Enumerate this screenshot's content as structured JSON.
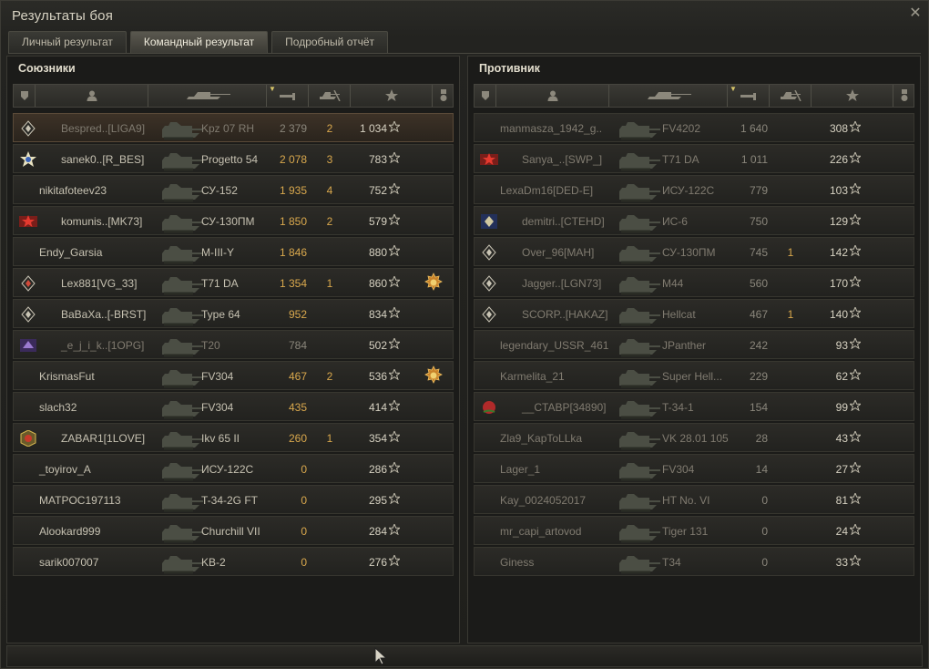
{
  "window": {
    "title": "Результаты боя",
    "close_icon": "close-icon"
  },
  "tabs": [
    {
      "label": "Личный результат",
      "active": false
    },
    {
      "label": "Командный результат",
      "active": true
    },
    {
      "label": "Подробный отчёт",
      "active": false
    }
  ],
  "allies": {
    "title": "Союзники",
    "rows": [
      {
        "badge": "clan-diamond",
        "player": "Bespred..[LIGA9]",
        "vehicle": "Kpz 07 RH",
        "damage": "2 379",
        "kills": "2",
        "xp": "1 034",
        "self": true,
        "dead": true,
        "medal": ""
      },
      {
        "badge": "clan-star",
        "player": "sanek0..[R_BES]",
        "vehicle": "Progetto 54",
        "damage": "2 078",
        "kills": "3",
        "xp": "783",
        "medal": ""
      },
      {
        "badge": "",
        "player": "nikitafoteev23",
        "vehicle": "СУ-152",
        "damage": "1 935",
        "kills": "4",
        "xp": "752",
        "medal": ""
      },
      {
        "badge": "clan-red-star",
        "player": "komunis..[MK73]",
        "vehicle": "СУ-130ПМ",
        "damage": "1 850",
        "kills": "2",
        "xp": "579",
        "medal": ""
      },
      {
        "badge": "",
        "player": "Endy_Garsia",
        "vehicle": "M-III-Y",
        "damage": "1 846",
        "kills": "",
        "xp": "880",
        "medal": ""
      },
      {
        "badge": "clan-diamond-red",
        "player": "Lex881[VG_33]",
        "vehicle": "T71 DA",
        "damage": "1 354",
        "kills": "1",
        "xp": "860",
        "medal": "medal-icon"
      },
      {
        "badge": "clan-diamond",
        "player": "BaBaXa..[-BRST]",
        "vehicle": "Type 64",
        "damage": "952",
        "kills": "",
        "xp": "834",
        "medal": ""
      },
      {
        "badge": "clan-purple",
        "player": "_e_j_i_k..[1OPG]",
        "vehicle": "T20",
        "damage": "784",
        "kills": "",
        "xp": "502",
        "dead": true,
        "medal": ""
      },
      {
        "badge": "",
        "player": "KrismasFut",
        "vehicle": "FV304",
        "damage": "467",
        "kills": "2",
        "xp": "536",
        "medal": "medal-icon"
      },
      {
        "badge": "",
        "player": "slach32",
        "vehicle": "FV304",
        "damage": "435",
        "kills": "",
        "xp": "414",
        "medal": ""
      },
      {
        "badge": "clan-gold",
        "player": "ZABAR1[1LOVE]",
        "vehicle": "Ikv 65 II",
        "damage": "260",
        "kills": "1",
        "xp": "354",
        "medal": ""
      },
      {
        "badge": "",
        "player": "_toyirov_A",
        "vehicle": "ИСУ-122С",
        "damage": "0",
        "kills": "",
        "xp": "286",
        "medal": ""
      },
      {
        "badge": "",
        "player": "MATPOC197113",
        "vehicle": "T-34-2G FT",
        "damage": "0",
        "kills": "",
        "xp": "295",
        "medal": ""
      },
      {
        "badge": "",
        "player": "Alookard999",
        "vehicle": "Churchill VII",
        "damage": "0",
        "kills": "",
        "xp": "284",
        "medal": ""
      },
      {
        "badge": "",
        "player": "sarik007007",
        "vehicle": "KB-2",
        "damage": "0",
        "kills": "",
        "xp": "276",
        "medal": ""
      }
    ]
  },
  "enemies": {
    "title": "Противник",
    "rows": [
      {
        "badge": "",
        "player": "manmasza_1942_g..",
        "vehicle": "FV4202",
        "damage": "1 640",
        "kills": "",
        "xp": "308",
        "dead": true
      },
      {
        "badge": "clan-red-star",
        "player": "Sanya_..[SWP_]",
        "vehicle": "T71 DA",
        "damage": "1 011",
        "kills": "",
        "xp": "226",
        "dead": true
      },
      {
        "badge": "",
        "player": "LexaDm16[DED-E]",
        "vehicle": "ИСУ-122С",
        "damage": "779",
        "kills": "",
        "xp": "103",
        "dead": true
      },
      {
        "badge": "clan-blue",
        "player": "demitri..[CTEHD]",
        "vehicle": "ИС-6",
        "damage": "750",
        "kills": "",
        "xp": "129",
        "dead": true
      },
      {
        "badge": "clan-diamond",
        "player": "Over_96[MAH]",
        "vehicle": "СУ-130ПМ",
        "damage": "745",
        "kills": "1",
        "xp": "142",
        "dead": true
      },
      {
        "badge": "clan-diamond",
        "player": "Jagger..[LGN73]",
        "vehicle": "M44",
        "damage": "560",
        "kills": "",
        "xp": "170",
        "dead": true
      },
      {
        "badge": "clan-diamond",
        "player": "SCORP..[HAKAZ]",
        "vehicle": "Hellcat",
        "damage": "467",
        "kills": "1",
        "xp": "140",
        "dead": true
      },
      {
        "badge": "",
        "player": "legendary_USSR_461",
        "vehicle": "JPanther",
        "damage": "242",
        "kills": "",
        "xp": "93",
        "dead": true
      },
      {
        "badge": "",
        "player": "Karmelita_21",
        "vehicle": "Super Hell...",
        "damage": "229",
        "kills": "",
        "xp": "62",
        "dead": true
      },
      {
        "badge": "clan-rose",
        "player": "__CTABP[34890]",
        "vehicle": "T-34-1",
        "damage": "154",
        "kills": "",
        "xp": "99",
        "dead": true
      },
      {
        "badge": "",
        "player": "Zla9_KapToLLka",
        "vehicle": "VK 28.01 105",
        "damage": "28",
        "kills": "",
        "xp": "43",
        "dead": true
      },
      {
        "badge": "",
        "player": "Lager_1",
        "vehicle": "FV304",
        "damage": "14",
        "kills": "",
        "xp": "27",
        "dead": true
      },
      {
        "badge": "",
        "player": "Kay_0024052017",
        "vehicle": "HT No. VI",
        "damage": "0",
        "kills": "",
        "xp": "81",
        "dead": true
      },
      {
        "badge": "",
        "player": "mr_capi_artovod",
        "vehicle": "Tiger 131",
        "damage": "0",
        "kills": "",
        "xp": "24",
        "dead": true
      },
      {
        "badge": "",
        "player": "Giness",
        "vehicle": "T34",
        "damage": "0",
        "kills": "",
        "xp": "33",
        "dead": true
      }
    ]
  },
  "columns": [
    "squad-icon",
    "player-icon",
    "tank-icon",
    "damage-icon",
    "kills-icon",
    "xp-star-icon",
    "medal-icon"
  ],
  "colors": {
    "damage": "#d9a84d",
    "dead_text": "#807b70",
    "accent_sort": "#d8c66a"
  }
}
